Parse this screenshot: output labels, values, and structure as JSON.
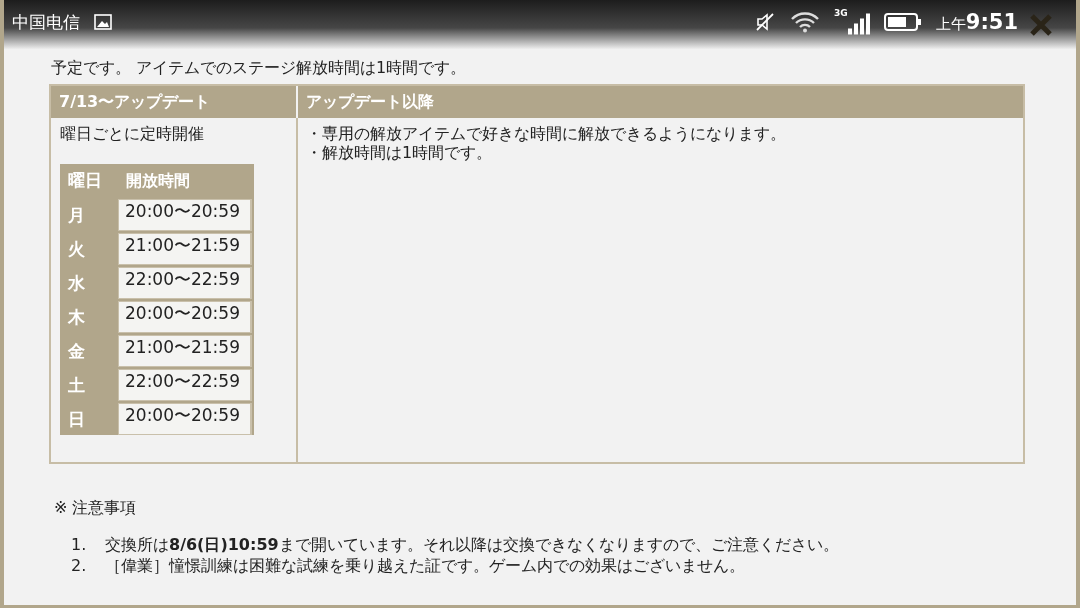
{
  "status_bar": {
    "carrier": "中国电信",
    "network": "3G",
    "time_prefix": "上午",
    "time": "9:51"
  },
  "intro": "予定です。 アイテムでのステージ解放時間は1時間です。",
  "table": {
    "columns": [
      "7/13〜アップデート",
      "アップデート以降"
    ],
    "before": {
      "title": "曜日ごとに定時開催",
      "schedule": {
        "columns": [
          "曜日",
          "開放時間"
        ],
        "rows": [
          {
            "day": "月",
            "time": "20:00〜20:59"
          },
          {
            "day": "火",
            "time": "21:00〜21:59"
          },
          {
            "day": "水",
            "time": "22:00〜22:59"
          },
          {
            "day": "木",
            "time": "20:00〜20:59"
          },
          {
            "day": "金",
            "time": "21:00〜21:59"
          },
          {
            "day": "土",
            "time": "22:00〜22:59"
          },
          {
            "day": "日",
            "time": "20:00〜20:59"
          }
        ]
      }
    },
    "after": [
      "・専用の解放アイテムで好きな時間に解放できるようになります。",
      "・解放時間は1時間です。"
    ]
  },
  "notes": {
    "title": "※ 注意事項",
    "items": [
      {
        "number": "1.",
        "text": "交換所は**8/6(日)10:59**まで開いています。それ以降は交換できなくなりますので、ご注意ください。"
      },
      {
        "number": "2.",
        "text": "［偉業］憧憬訓練は困難な試練を乗り越えた証です。ゲーム内での効果はございません。"
      }
    ]
  }
}
